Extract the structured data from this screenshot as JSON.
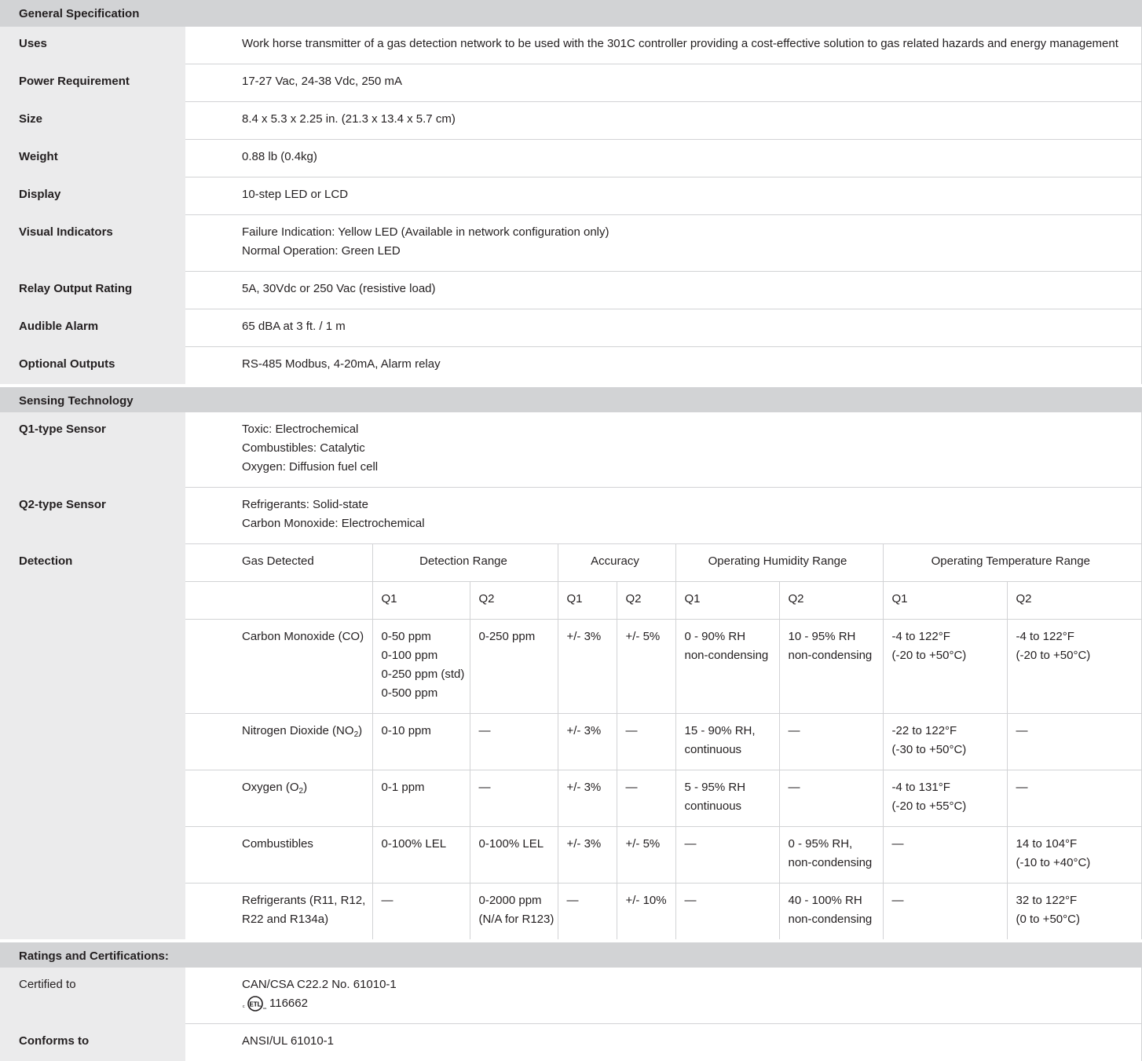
{
  "general": {
    "title": "General Specification",
    "rows": [
      {
        "label": "Uses",
        "lines": [
          "Work horse transmitter of a gas detection network to be used with the 301C controller providing a cost-effective solution to gas related hazards and energy management"
        ]
      },
      {
        "label": "Power Requirement",
        "lines": [
          "17-27 Vac, 24-38 Vdc, 250 mA"
        ]
      },
      {
        "label": "Size",
        "lines": [
          "8.4 x 5.3 x 2.25 in. (21.3 x 13.4 x 5.7 cm)"
        ]
      },
      {
        "label": "Weight",
        "lines": [
          "0.88 lb (0.4kg)"
        ]
      },
      {
        "label": "Display",
        "lines": [
          "10-step LED or LCD"
        ]
      },
      {
        "label": "Visual Indicators",
        "lines": [
          "Failure Indication: Yellow LED (Available in network configuration only)",
          "Normal Operation: Green LED"
        ]
      },
      {
        "label": "Relay Output Rating",
        "lines": [
          "5A, 30Vdc or 250 Vac (resistive load)"
        ]
      },
      {
        "label": "Audible Alarm",
        "lines": [
          "65 dBA at 3 ft. / 1 m"
        ]
      },
      {
        "label": "Optional Outputs",
        "lines": [
          "RS-485 Modbus, 4-20mA, Alarm relay"
        ]
      }
    ]
  },
  "sensing": {
    "title": "Sensing Technology",
    "rows": [
      {
        "label": "Q1-type Sensor",
        "lines": [
          "Toxic: Electrochemical",
          "Combustibles: Catalytic",
          "Oxygen: Diffusion fuel cell"
        ]
      },
      {
        "label": "Q2-type Sensor",
        "lines": [
          "Refrigerants: Solid-state",
          "Carbon Monoxide: Electrochemical"
        ]
      }
    ]
  },
  "detection": {
    "label": "Detection",
    "headers": {
      "gas": "Gas Detected",
      "range": "Detection Range",
      "accuracy": "Accuracy",
      "humidity": "Operating Humidity Range",
      "temperature": "Operating Temperature Range"
    },
    "subheaders": [
      "Q1",
      "Q2",
      "Q1",
      "Q2",
      "Q1",
      "Q2",
      "Q1",
      "Q2"
    ],
    "rows": [
      {
        "gas": [
          "Carbon Monoxide (CO)"
        ],
        "cells": [
          [
            "0-50 ppm",
            "0-100 ppm",
            "0-250 ppm (std)",
            "0-500 ppm"
          ],
          [
            "0-250 ppm"
          ],
          [
            "+/- 3%"
          ],
          [
            "+/- 5%"
          ],
          [
            "0 - 90% RH",
            "non-condensing"
          ],
          [
            "10 - 95% RH",
            "non-condensing"
          ],
          [
            "-4 to 122°F",
            "(-20 to +50°C)"
          ],
          [
            "-4 to 122°F",
            "(-20 to +50°C)"
          ]
        ]
      },
      {
        "gas_prefix": "Nitrogen Dioxide (NO",
        "gas_sub": "2",
        "gas_suffix": ")",
        "cells": [
          [
            "0-10 ppm"
          ],
          [
            "—"
          ],
          [
            "+/- 3%"
          ],
          [
            "—"
          ],
          [
            "15 - 90% RH,",
            "continuous"
          ],
          [
            "—"
          ],
          [
            "-22 to 122°F",
            "(-30 to +50°C)"
          ],
          [
            "—"
          ]
        ]
      },
      {
        "gas_prefix": "Oxygen (O",
        "gas_sub": "2",
        "gas_suffix": ")",
        "cells": [
          [
            "0-1 ppm"
          ],
          [
            "—"
          ],
          [
            "+/- 3%"
          ],
          [
            "—"
          ],
          [
            "5 - 95% RH",
            "continuous"
          ],
          [
            "—"
          ],
          [
            "-4 to 131°F",
            "(-20 to +55°C)"
          ],
          [
            "—"
          ]
        ]
      },
      {
        "gas": [
          "Combustibles"
        ],
        "cells": [
          [
            "0-100% LEL"
          ],
          [
            "0-100% LEL"
          ],
          [
            "+/- 3%"
          ],
          [
            "+/- 5%"
          ],
          [
            "—"
          ],
          [
            "0 - 95% RH,",
            "non-condensing"
          ],
          [
            "—"
          ],
          [
            "14 to 104°F",
            "(-10 to +40°C)"
          ]
        ]
      },
      {
        "gas": [
          "Refrigerants (R11, R12,",
          "R22 and R134a)"
        ],
        "cells": [
          [
            "—"
          ],
          [
            "0-2000 ppm",
            "(N/A for R123)"
          ],
          [
            "—"
          ],
          [
            "+/- 10%"
          ],
          [
            "—"
          ],
          [
            "40 - 100% RH",
            "non-condensing"
          ],
          [
            "—"
          ],
          [
            "32 to 122°F",
            "(0 to +50°C)"
          ]
        ]
      }
    ]
  },
  "ratings": {
    "title": "Ratings and Certifications:",
    "certified_label": "Certified to",
    "certified_line1": "CAN/CSA C22.2 No. 61010-1",
    "etl_logo_text": "ETL",
    "etl_number": "116662",
    "conforms_label": "Conforms to",
    "conforms_value": "ANSI/UL 61010-1"
  },
  "colors": {
    "section_band": "#d2d3d5",
    "label_column": "#ebebec",
    "rule": "#d2d3d5",
    "text": "#231f20"
  }
}
